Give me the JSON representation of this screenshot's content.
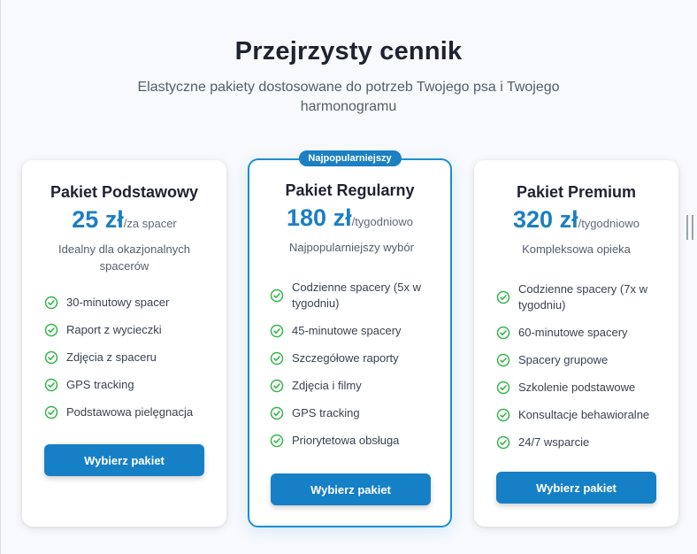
{
  "header": {
    "title": "Przejrzysty cennik",
    "subtitle": "Elastyczne pakiety dostosowane do potrzeb Twojego psa i Twojego harmonogramu"
  },
  "plans": [
    {
      "name": "Pakiet Podstawowy",
      "price": "25 zł",
      "period": "/za spacer",
      "description": "Idealny dla okazjonalnych spacerów",
      "features": [
        "30-minutowy spacer",
        "Raport z wycieczki",
        "Zdjęcia z spaceru",
        "GPS tracking",
        "Podstawowa pielęgnacja"
      ],
      "button": "Wybierz pakiet"
    },
    {
      "name": "Pakiet Regularny",
      "badge": "Najpopularniejszy",
      "price": "180 zł",
      "period": "/tygodniowo",
      "description": "Najpopularniejszy wybór",
      "features": [
        "Codzienne spacery (5x w tygodniu)",
        "45-minutowe spacery",
        "Szczegółowe raporty",
        "Zdjęcia i filmy",
        "GPS tracking",
        "Priorytetowa obsługa"
      ],
      "button": "Wybierz pakiet"
    },
    {
      "name": "Pakiet Premium",
      "price": "320 zł",
      "period": "/tygodniowo",
      "description": "Kompleksowa opieka",
      "features": [
        "Codzienne spacery (7x w tygodniu)",
        "60-minutowe spacery",
        "Spacery grupowe",
        "Szkolenie podstawowe",
        "Konsultacje behawioralne",
        "24/7 wsparcie"
      ],
      "button": "Wybierz pakiet"
    }
  ],
  "icons": {
    "feature_check": "check-circle-icon",
    "scroll": "drag-handle-icon"
  },
  "colors": {
    "accent": "#1680c6",
    "check": "#35b44a",
    "featured_border": "#1b8fd1"
  }
}
